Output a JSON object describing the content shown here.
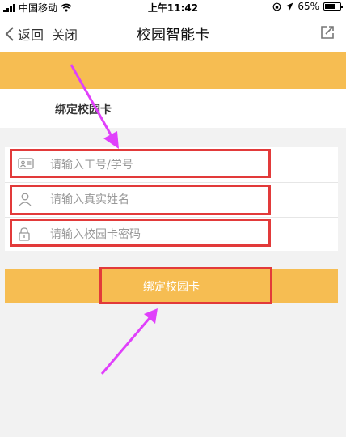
{
  "status_bar": {
    "carrier": "中国移动",
    "time": "上午11:42",
    "battery_text": "65%",
    "battery_level": 0.65
  },
  "nav": {
    "back_label": "返回",
    "close_label": "关闭",
    "title": "校园智能卡"
  },
  "tab": {
    "label": "绑定校园卡"
  },
  "form": {
    "fields": [
      {
        "icon": "id-card-icon",
        "placeholder": "请输入工号/学号"
      },
      {
        "icon": "user-icon",
        "placeholder": "请输入真实姓名"
      },
      {
        "icon": "lock-icon",
        "placeholder": "请输入校园卡密码"
      }
    ],
    "submit_label": "绑定校园卡"
  },
  "colors": {
    "accent": "#f6bd52",
    "highlight": "#e23a3a",
    "arrow": "#e040fb"
  }
}
